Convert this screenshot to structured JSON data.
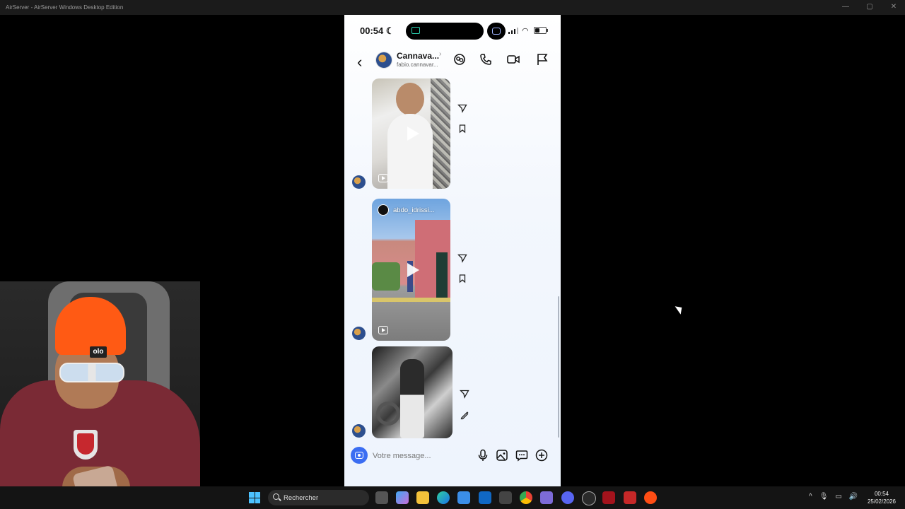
{
  "window": {
    "title": "AirServer - AirServer Windows Desktop Edition",
    "controls": {
      "minimize": "—",
      "maximize": "▢",
      "close": "✕"
    }
  },
  "phone": {
    "status_bar": {
      "time": "00:54",
      "icons": [
        "moon-icon",
        "airplay-icon",
        "screen-mirroring-icon",
        "signal-icon",
        "wifi-icon",
        "battery-icon"
      ]
    },
    "header": {
      "back_icon": "chevron-left-icon",
      "display_name": "Cannava...",
      "username": "fabio.cannavar...",
      "actions": [
        "sticker-icon",
        "phone-icon",
        "video-icon",
        "flag-icon"
      ]
    },
    "messages": [
      {
        "type": "reel",
        "caption": "",
        "actions": [
          "share-icon",
          "save-icon"
        ]
      },
      {
        "type": "reel",
        "caption": "abdo_idrissi...",
        "actions": [
          "share-icon",
          "save-icon"
        ]
      },
      {
        "type": "photo",
        "caption": "",
        "actions": [
          "share-icon",
          "edit-icon"
        ]
      }
    ],
    "composer": {
      "placeholder": "Votre message...",
      "actions": [
        "microphone-icon",
        "gallery-icon",
        "sticker-chat-icon",
        "plus-icon"
      ]
    }
  },
  "webcam": {
    "beanie_text": "olo"
  },
  "taskbar": {
    "search_label": "Rechercher",
    "apps": [
      "task-view",
      "copilot",
      "file-explorer",
      "edge",
      "store",
      "outlook",
      "media",
      "chrome",
      "gaming",
      "discord",
      "obs",
      "acrobat",
      "game-launcher",
      "ea"
    ],
    "tray": {
      "time": "00:54",
      "date": "25/02/2026"
    }
  }
}
